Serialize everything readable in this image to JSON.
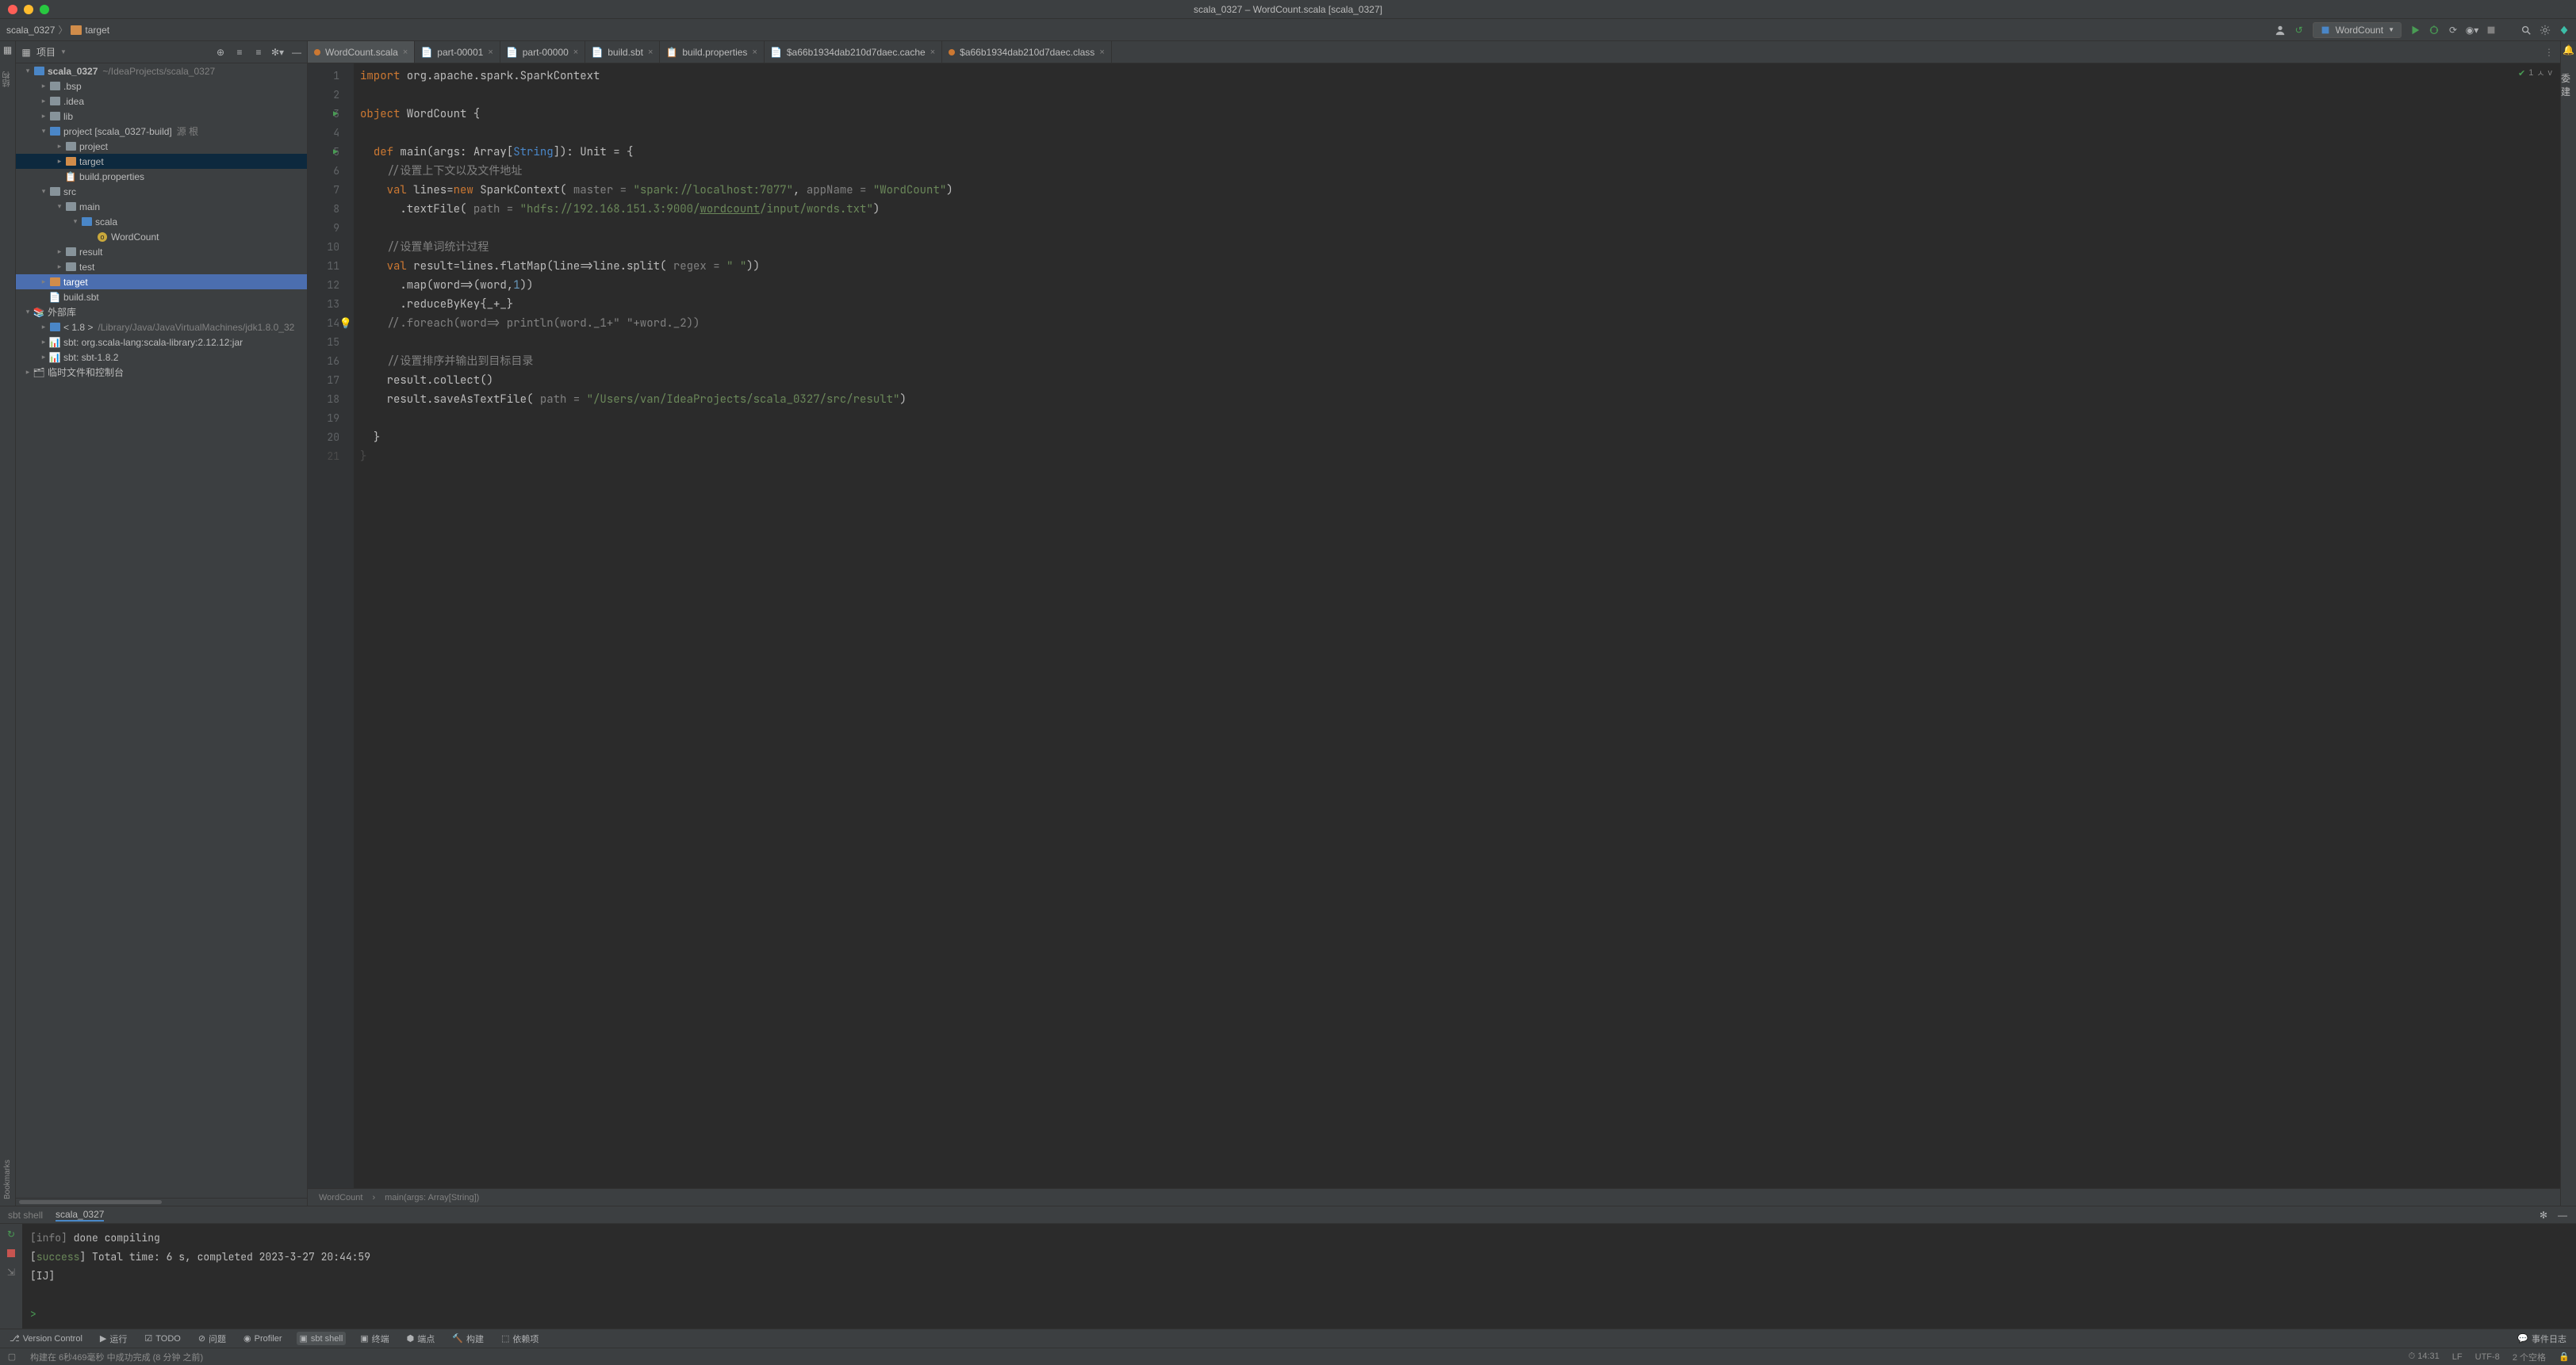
{
  "title": "scala_0327 – WordCount.scala [scala_0327]",
  "breadcrumb": {
    "root": "scala_0327",
    "item": "target"
  },
  "run_config": "WordCount",
  "project_header": "项目",
  "tree": {
    "root": {
      "name": "scala_0327",
      "path": "~/IdeaProjects/scala_0327"
    },
    "bsp": ".bsp",
    "idea": ".idea",
    "lib": "lib",
    "project": {
      "name": "project [scala_0327-build]",
      "hint": "源 根"
    },
    "project_sub": "project",
    "target_sub": "target",
    "buildprops": "build.properties",
    "src": "src",
    "main": "main",
    "scala": "scala",
    "wordcount": "WordCount",
    "result": "result",
    "test": "test",
    "target": "target",
    "buildsbt": "build.sbt",
    "extlib": "外部库",
    "jdk": {
      "name": "< 1.8 >",
      "path": "/Library/Java/JavaVirtualMachines/jdk1.8.0_32"
    },
    "sbt1": "sbt: org.scala-lang:scala-library:2.12.12:jar",
    "sbt2": "sbt: sbt-1.8.2",
    "scratch": "临时文件和控制台"
  },
  "tabs": [
    {
      "label": "WordCount.scala",
      "active": true
    },
    {
      "label": "part-00001"
    },
    {
      "label": "part-00000"
    },
    {
      "label": "build.sbt"
    },
    {
      "label": "build.properties"
    },
    {
      "label": "$a66b1934dab210d7daec.cache"
    },
    {
      "label": "$a66b1934dab210d7daec.class"
    }
  ],
  "problem_count": "1",
  "crumbs": {
    "c1": "WordCount",
    "sep": "›",
    "c2": "main(args: Array[String])"
  },
  "code": {
    "l1a": "import",
    "l1b": " org.apache.spark.SparkContext",
    "l3a": "object",
    "l3b": " WordCount {",
    "l5a": "def",
    "l5b": " main(args: Array[",
    "l5c": "String",
    "l5d": "]): Unit = {",
    "l6": "//设置上下文以及文件地址",
    "l7a": "val",
    "l7b": " lines=",
    "l7c": "new",
    "l7d": " SparkContext( ",
    "l7e": "master = ",
    "l7f": "\"spark://localhost:7077\"",
    "l7g": ", ",
    "l7h": "appName = ",
    "l7i": "\"WordCount\"",
    "l7j": ")",
    "l8a": ".textFile( ",
    "l8b": "path = ",
    "l8c1": "\"hdfs://192.168.151.3:9000/",
    "l8c2": "wordcount",
    "l8c3": "/input/words.txt\"",
    "l8d": ")",
    "l10": "//设置单词统计过程",
    "l11a": "val",
    "l11b": " result=lines.flatMap(line=>line.split( ",
    "l11c": "regex = ",
    "l11d": "\" \"",
    "l11e": "))",
    "l12a": ".map(word=>(word,",
    "l12b": "1",
    "l12c": "))",
    "l13": ".reduceByKey{_+_}",
    "l14": "//.foreach(word=> println(word._1+\" \"+word._2))",
    "l16": "//设置排序并输出到目标目录",
    "l17": "result.collect()",
    "l18a": "result.saveAsTextFile( ",
    "l18b": "path = ",
    "l18c": "\"/Users/van/IdeaProjects/scala_0327/src/result\"",
    "l18d": ")",
    "l20": "}",
    "l21": "}"
  },
  "console_tabs": {
    "sbtshell": "sbt shell",
    "projname": "scala_0327"
  },
  "console": {
    "l1a": "[info]",
    "l1b": " done compiling",
    "l2a": "[",
    "l2b": "success",
    "l2c": "] Total time: 6 s, completed 2023-3-27 20:44:59",
    "l3": "[IJ]",
    "prompt": ">"
  },
  "bottom": {
    "vcs": "Version Control",
    "run": "运行",
    "todo": "TODO",
    "problems": "问题",
    "profiler": "Profiler",
    "sbtshell": "sbt shell",
    "terminal": "终端",
    "endpoints": "端点",
    "build": "构建",
    "dependencies": "依赖项",
    "eventlog": "事件日志"
  },
  "status": {
    "msg": "构建在 6秒469毫秒 中成功完成 (8 分钟 之前)",
    "time": "14:31",
    "lf": "LF",
    "enc": "UTF-8",
    "indent": "2 个空格"
  }
}
